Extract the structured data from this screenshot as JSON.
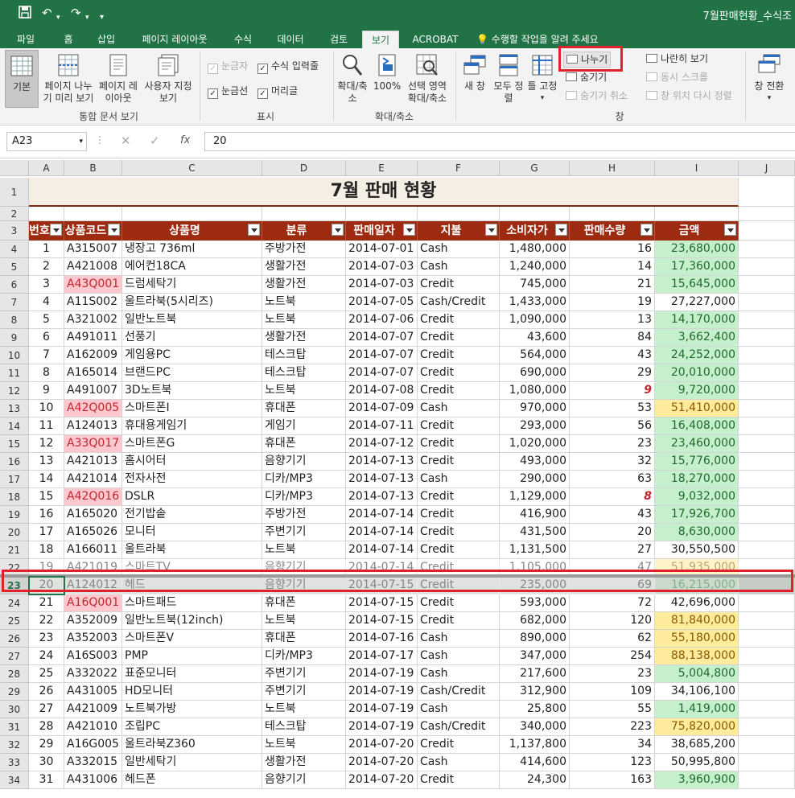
{
  "window": {
    "title": "7월판매현황_수식조"
  },
  "qat": {
    "save_icon": "save-icon",
    "undo_icon": "undo-icon",
    "redo_icon": "redo-icon"
  },
  "tabs": [
    {
      "label": "파일"
    },
    {
      "label": "홈"
    },
    {
      "label": "삽입"
    },
    {
      "label": "페이지 레이아웃"
    },
    {
      "label": "수식"
    },
    {
      "label": "데이터"
    },
    {
      "label": "검토"
    },
    {
      "label": "보기"
    },
    {
      "label": "ACROBAT"
    }
  ],
  "tell_me": "수행할 작업을 알려 주세요",
  "ribbon": {
    "views": {
      "normal": "기본",
      "pagebreak": "페이지 나누기 미리 보기",
      "pagelayout": "페이지 레이아웃",
      "custom": "사용자 지정 보기",
      "group": "통합 문서 보기"
    },
    "show": {
      "ruler": "눈금자",
      "formula_bar": "수식 입력줄",
      "gridlines": "눈금선",
      "headings": "머리글",
      "group": "표시"
    },
    "zoom": {
      "zoom": "확대/축소",
      "z100": "100%",
      "zoom_sel": "선택 영역 확대/축소",
      "group": "확대/축소"
    },
    "window": {
      "new_window": "새 창",
      "arrange_all": "모두 정렬",
      "freeze": "틀 고정",
      "split": "나누기",
      "hide": "숨기기",
      "unhide": "숨기기 취소",
      "side_by_side": "나란히 보기",
      "sync_scroll": "동시 스크롤",
      "reset_pos": "창 위치 다시 정렬",
      "switch": "창 전환",
      "group": "창"
    }
  },
  "formula_bar": {
    "name_box": "A23",
    "formula": "20",
    "fx": "fx"
  },
  "columns": [
    "A",
    "B",
    "C",
    "D",
    "E",
    "F",
    "G",
    "H",
    "I",
    "J"
  ],
  "sheet_title": "7월 판매 현황",
  "headers": [
    "번호",
    "상품코드",
    "상품명",
    "분류",
    "판매일자",
    "지불",
    "소비자가",
    "판매수량",
    "금액"
  ],
  "row_numbers": [
    "1",
    "2",
    "3",
    "4",
    "5",
    "6",
    "7",
    "8",
    "9",
    "10",
    "11",
    "12",
    "13",
    "14",
    "15",
    "16",
    "17",
    "18",
    "19",
    "20",
    "21",
    "22",
    "23",
    "24",
    "25",
    "26",
    "27",
    "28",
    "29",
    "30",
    "31",
    "32",
    "33",
    "34"
  ],
  "rows": [
    {
      "n": "1",
      "code": "A315007",
      "name": "냉장고 736ml",
      "cat": "주방가전",
      "date": "2014-07-01",
      "pay": "Cash",
      "price": "1,480,000",
      "qty": "16",
      "amt": "23,680,000",
      "hl": "green"
    },
    {
      "n": "2",
      "code": "A421008",
      "name": "에어컨18CA",
      "cat": "생활가전",
      "date": "2014-07-03",
      "pay": "Cash",
      "price": "1,240,000",
      "qty": "14",
      "amt": "17,360,000",
      "hl": "green"
    },
    {
      "n": "3",
      "code": "A43Q001",
      "name": "드럼세탁기",
      "cat": "생활가전",
      "date": "2014-07-03",
      "pay": "Credit",
      "price": "745,000",
      "qty": "21",
      "amt": "15,645,000",
      "hl": "green",
      "codehl": true
    },
    {
      "n": "4",
      "code": "A11S002",
      "name": "울트라북(5시리즈)",
      "cat": "노트북",
      "date": "2014-07-05",
      "pay": "Cash/Credit",
      "price": "1,433,000",
      "qty": "19",
      "amt": "27,227,000",
      "hl": ""
    },
    {
      "n": "5",
      "code": "A321002",
      "name": "일반노트북",
      "cat": "노트북",
      "date": "2014-07-06",
      "pay": "Credit",
      "price": "1,090,000",
      "qty": "13",
      "amt": "14,170,000",
      "hl": "green"
    },
    {
      "n": "6",
      "code": "A491011",
      "name": "선풍기",
      "cat": "생활가전",
      "date": "2014-07-07",
      "pay": "Credit",
      "price": "43,600",
      "qty": "84",
      "amt": "3,662,400",
      "hl": "green"
    },
    {
      "n": "7",
      "code": "A162009",
      "name": "게임용PC",
      "cat": "테스크탑",
      "date": "2014-07-07",
      "pay": "Credit",
      "price": "564,000",
      "qty": "43",
      "amt": "24,252,000",
      "hl": "green"
    },
    {
      "n": "8",
      "code": "A165014",
      "name": "브랜드PC",
      "cat": "테스크탑",
      "date": "2014-07-07",
      "pay": "Credit",
      "price": "690,000",
      "qty": "29",
      "amt": "20,010,000",
      "hl": "green"
    },
    {
      "n": "9",
      "code": "A491007",
      "name": "3D노트북",
      "cat": "노트북",
      "date": "2014-07-08",
      "pay": "Credit",
      "price": "1,080,000",
      "qty": "9",
      "amt": "9,720,000",
      "hl": "green",
      "qtyred": true
    },
    {
      "n": "10",
      "code": "A42Q005",
      "name": "스마트폰I",
      "cat": "휴대폰",
      "date": "2014-07-09",
      "pay": "Cash",
      "price": "970,000",
      "qty": "53",
      "amt": "51,410,000",
      "hl": "yellow",
      "codehl": true
    },
    {
      "n": "11",
      "code": "A124013",
      "name": "휴대용게임기",
      "cat": "게임기",
      "date": "2014-07-11",
      "pay": "Credit",
      "price": "293,000",
      "qty": "56",
      "amt": "16,408,000",
      "hl": "green"
    },
    {
      "n": "12",
      "code": "A33Q017",
      "name": "스마트폰G",
      "cat": "휴대폰",
      "date": "2014-07-12",
      "pay": "Credit",
      "price": "1,020,000",
      "qty": "23",
      "amt": "23,460,000",
      "hl": "green",
      "codehl": true
    },
    {
      "n": "13",
      "code": "A421013",
      "name": "홈시어터",
      "cat": "음향기기",
      "date": "2014-07-13",
      "pay": "Credit",
      "price": "493,000",
      "qty": "32",
      "amt": "15,776,000",
      "hl": "green"
    },
    {
      "n": "14",
      "code": "A421014",
      "name": "전자사전",
      "cat": "디카/MP3",
      "date": "2014-07-13",
      "pay": "Cash",
      "price": "290,000",
      "qty": "63",
      "amt": "18,270,000",
      "hl": "green"
    },
    {
      "n": "15",
      "code": "A42Q016",
      "name": "DSLR",
      "cat": "디카/MP3",
      "date": "2014-07-13",
      "pay": "Credit",
      "price": "1,129,000",
      "qty": "8",
      "amt": "9,032,000",
      "hl": "green",
      "codehl": true,
      "qtyred": true
    },
    {
      "n": "16",
      "code": "A165020",
      "name": "전기밥솥",
      "cat": "주방가전",
      "date": "2014-07-14",
      "pay": "Credit",
      "price": "416,900",
      "qty": "43",
      "amt": "17,926,700",
      "hl": "green"
    },
    {
      "n": "17",
      "code": "A165026",
      "name": "모니터",
      "cat": "주변기기",
      "date": "2014-07-14",
      "pay": "Credit",
      "price": "431,500",
      "qty": "20",
      "amt": "8,630,000",
      "hl": "green"
    },
    {
      "n": "18",
      "code": "A166011",
      "name": "울트라북",
      "cat": "노트북",
      "date": "2014-07-14",
      "pay": "Credit",
      "price": "1,131,500",
      "qty": "27",
      "amt": "30,550,500",
      "hl": ""
    },
    {
      "n": "19",
      "code": "A421019",
      "name": "스마트TV",
      "cat": "음향기기",
      "date": "2014-07-14",
      "pay": "Credit",
      "price": "1,105,000",
      "qty": "47",
      "amt": "51,935,000",
      "hl": "yellow",
      "faded": true
    },
    {
      "n": "20",
      "code": "A124012",
      "name": "헤드",
      "cat": "음향기기",
      "date": "2014-07-15",
      "pay": "Credit",
      "price": "235,000",
      "qty": "69",
      "amt": "16,215,000",
      "hl": "green",
      "faded": true
    },
    {
      "n": "21",
      "code": "A16Q001",
      "name": "스마트패드",
      "cat": "휴대폰",
      "date": "2014-07-15",
      "pay": "Credit",
      "price": "593,000",
      "qty": "72",
      "amt": "42,696,000",
      "hl": "",
      "codehl": true
    },
    {
      "n": "22",
      "code": "A352009",
      "name": "일반노트북(12inch)",
      "cat": "노트북",
      "date": "2014-07-15",
      "pay": "Credit",
      "price": "682,000",
      "qty": "120",
      "amt": "81,840,000",
      "hl": "yellow"
    },
    {
      "n": "23",
      "code": "A352003",
      "name": "스마트폰V",
      "cat": "휴대폰",
      "date": "2014-07-16",
      "pay": "Cash",
      "price": "890,000",
      "qty": "62",
      "amt": "55,180,000",
      "hl": "yellow"
    },
    {
      "n": "24",
      "code": "A16S003",
      "name": "PMP",
      "cat": "디카/MP3",
      "date": "2014-07-17",
      "pay": "Cash",
      "price": "347,000",
      "qty": "254",
      "amt": "88,138,000",
      "hl": "yellow"
    },
    {
      "n": "25",
      "code": "A332022",
      "name": "표준모니터",
      "cat": "주변기기",
      "date": "2014-07-19",
      "pay": "Cash",
      "price": "217,600",
      "qty": "23",
      "amt": "5,004,800",
      "hl": "green"
    },
    {
      "n": "26",
      "code": "A431005",
      "name": "HD모니터",
      "cat": "주변기기",
      "date": "2014-07-19",
      "pay": "Cash/Credit",
      "price": "312,900",
      "qty": "109",
      "amt": "34,106,100",
      "hl": ""
    },
    {
      "n": "27",
      "code": "A421009",
      "name": "노트북가방",
      "cat": "노트북",
      "date": "2014-07-19",
      "pay": "Cash",
      "price": "25,800",
      "qty": "55",
      "amt": "1,419,000",
      "hl": "green"
    },
    {
      "n": "28",
      "code": "A421010",
      "name": "조립PC",
      "cat": "테스크탑",
      "date": "2014-07-19",
      "pay": "Cash/Credit",
      "price": "340,000",
      "qty": "223",
      "amt": "75,820,000",
      "hl": "yellow"
    },
    {
      "n": "29",
      "code": "A16G005",
      "name": "울트라북Z360",
      "cat": "노트북",
      "date": "2014-07-20",
      "pay": "Credit",
      "price": "1,137,800",
      "qty": "34",
      "amt": "38,685,200",
      "hl": ""
    },
    {
      "n": "30",
      "code": "A332015",
      "name": "일반세탁기",
      "cat": "생활가전",
      "date": "2014-07-20",
      "pay": "Cash",
      "price": "414,600",
      "qty": "123",
      "amt": "50,995,800",
      "hl": ""
    },
    {
      "n": "31",
      "code": "A431006",
      "name": "헤드폰",
      "cat": "음향기기",
      "date": "2014-07-20",
      "pay": "Credit",
      "price": "24,300",
      "qty": "163",
      "amt": "3,960,900",
      "hl": "green"
    }
  ],
  "colors": {
    "excel_green": "#217346",
    "header_red": "#9c2b12",
    "highlight_green": "#c6efce",
    "highlight_yellow": "#ffeb9c",
    "code_pink": "#ffc7ce",
    "annotation_red": "#e0202a"
  }
}
